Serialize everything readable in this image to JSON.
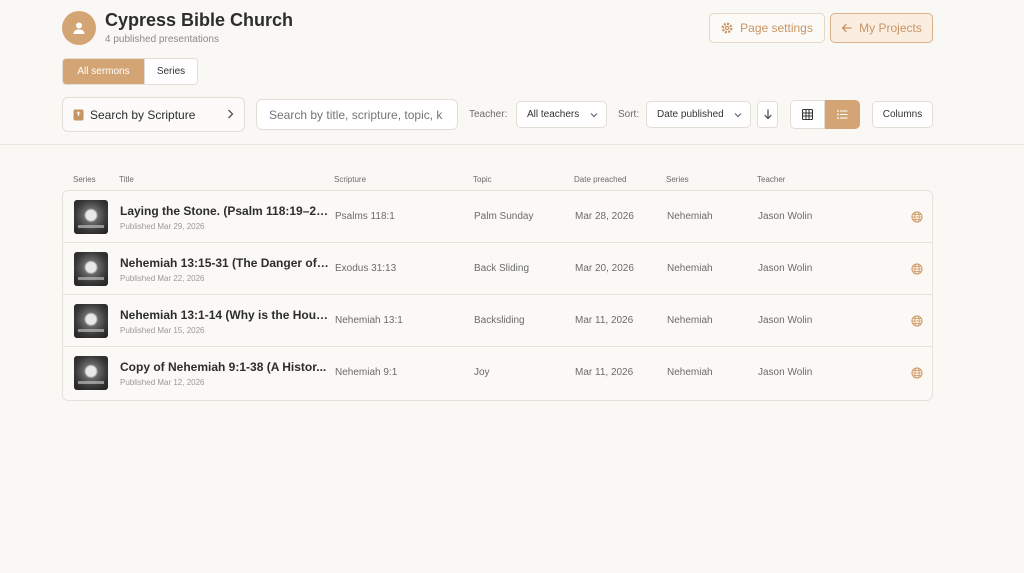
{
  "header": {
    "org_name": "Cypress Bible Church",
    "subtitle": "4 published presentations",
    "page_settings_label": "Page settings",
    "my_projects_label": "My Projects"
  },
  "tabs": [
    {
      "label": "All sermons",
      "active": true
    },
    {
      "label": "Series",
      "active": false
    }
  ],
  "toolbar": {
    "scripture_label": "Search by Scripture",
    "search_placeholder": "Search by title, scripture, topic, k",
    "teacher_label": "Teacher:",
    "teacher_value": "All teachers",
    "sort_label": "Sort:",
    "sort_value": "Date published",
    "columns_label": "Columns"
  },
  "table": {
    "headers": [
      "Series",
      "Title",
      "Scripture",
      "Topic",
      "Date preached",
      "Series",
      "Teacher"
    ],
    "rows": [
      {
        "title": "Laying the Stone. (Psalm 118:19–26;...",
        "published": "Published Mar 29, 2026",
        "scripture": "Psalms 118:1",
        "topic": "Palm Sunday",
        "date": "Mar 28, 2026",
        "series": "Nehemiah",
        "teacher": "Jason Wolin"
      },
      {
        "title": "Nehemiah 13:15-31 (The Danger of ...",
        "published": "Published Mar 22, 2026",
        "scripture": "Exodus 31:13",
        "topic": "Back Sliding",
        "date": "Mar 20, 2026",
        "series": "Nehemiah",
        "teacher": "Jason Wolin"
      },
      {
        "title": "Nehemiah 13:1-14 (Why is the Hous...",
        "published": "Published Mar 15, 2026",
        "scripture": "Nehemiah 13:1",
        "topic": "Backsliding",
        "date": "Mar 11, 2026",
        "series": "Nehemiah",
        "teacher": "Jason Wolin"
      },
      {
        "title": "Copy of Nehemiah 9:1-38 (A Histor...",
        "published": "Published Mar 12, 2026",
        "scripture": "Nehemiah 9:1",
        "topic": "Joy",
        "date": "Mar 11, 2026",
        "series": "Nehemiah",
        "teacher": "Jason Wolin"
      }
    ]
  },
  "colors": {
    "accent": "#d4a574",
    "background": "#faf8f5"
  }
}
